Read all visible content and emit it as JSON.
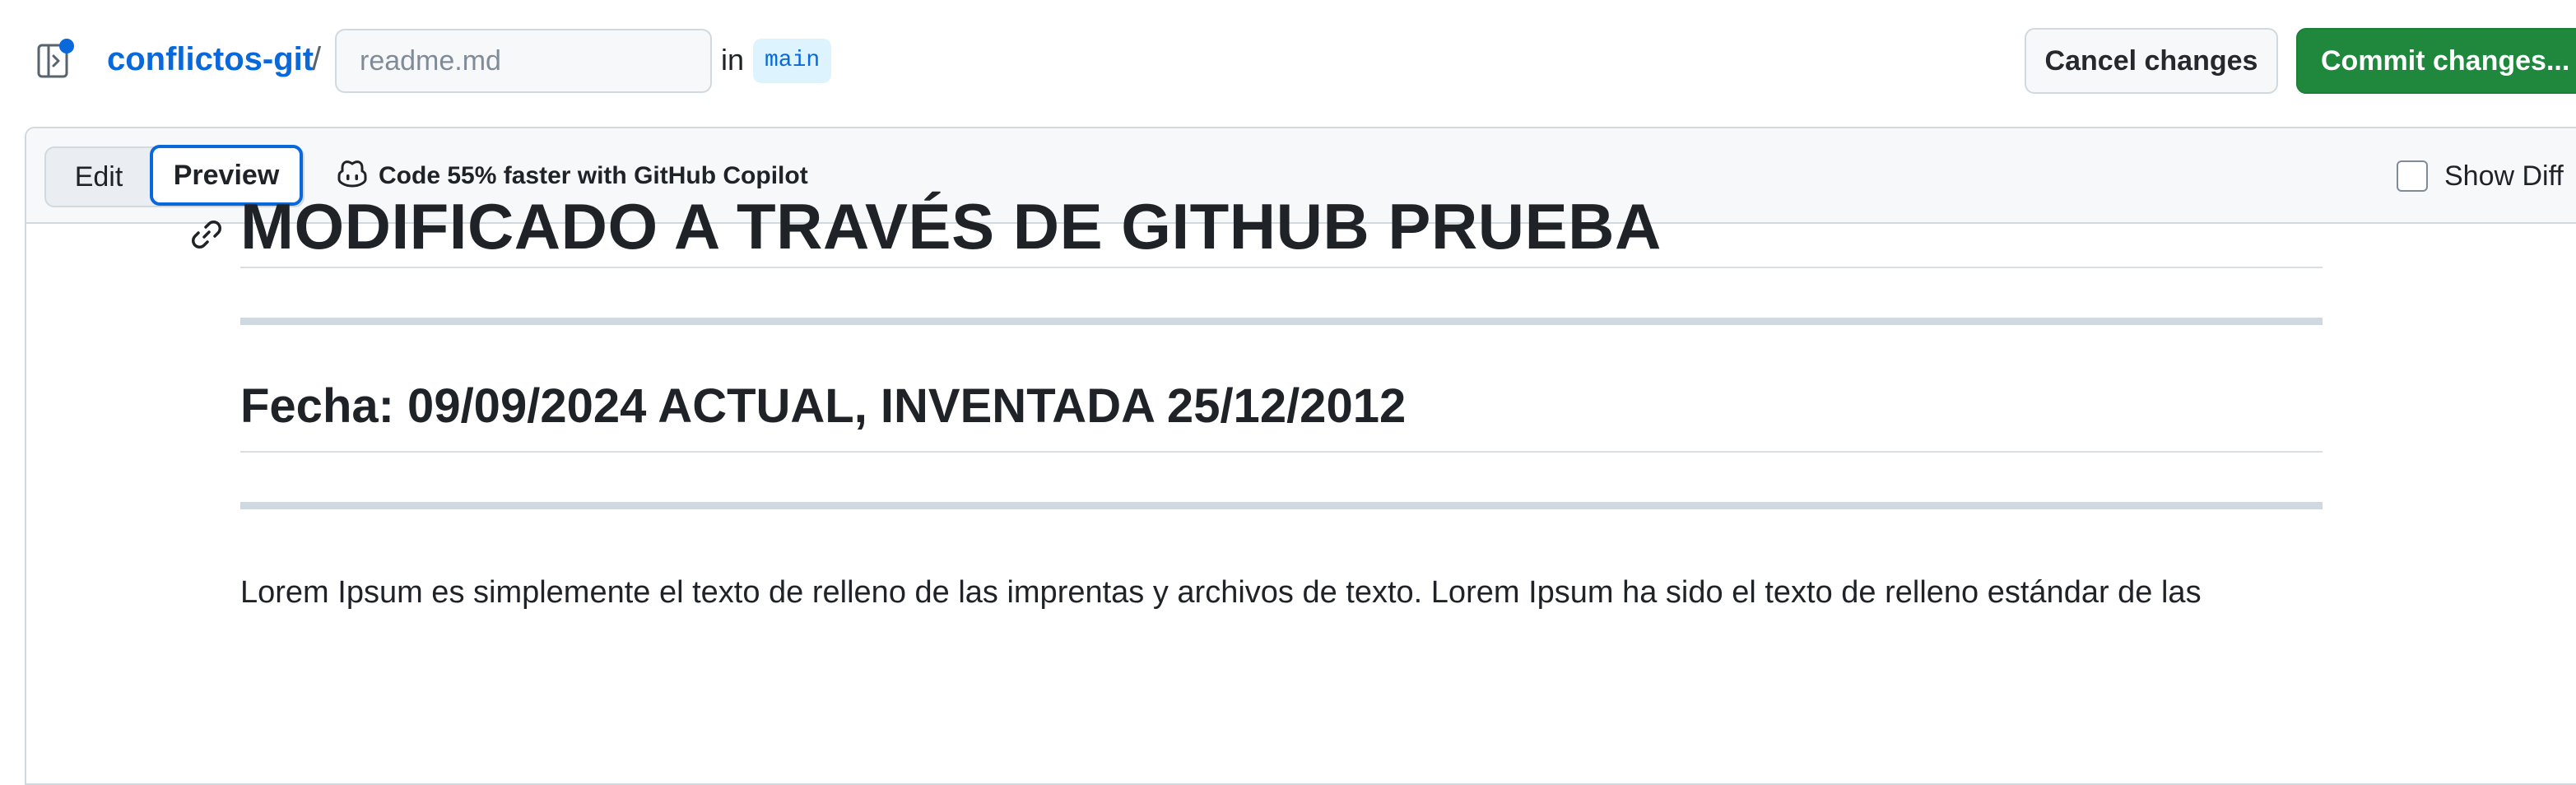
{
  "header": {
    "repo_name": "conflictos-git",
    "path_separator": "/",
    "filename_placeholder": "readme.md",
    "in_label": "in",
    "branch": "main",
    "cancel_label": "Cancel changes",
    "commit_label": "Commit changes..."
  },
  "toolbar": {
    "tabs": [
      {
        "label": "Edit",
        "active": false
      },
      {
        "label": "Preview",
        "active": true
      }
    ],
    "copilot_label": "Code 55% faster with GitHub Copilot",
    "show_diff_label": "Show Diff",
    "show_diff_checked": false
  },
  "preview": {
    "heading1": "MODIFICADO A TRAVÉS DE GITHUB PRUEBA",
    "heading2": "Fecha: 09/09/2024 ACTUAL, INVENTADA 25/12/2012",
    "paragraph": "Lorem Ipsum es simplemente el texto de relleno de las imprentas y archivos de texto. Lorem Ipsum ha sido el texto de relleno estándar de las"
  },
  "icons": {
    "sidebar_toggle": "sidebar-expand-icon",
    "copilot": "copilot-icon",
    "anchor": "link-icon"
  },
  "colors": {
    "link": "#0969da",
    "commit_green": "#1f883d",
    "branch_bg": "#ddf4ff",
    "focus_blue": "#0969da"
  }
}
